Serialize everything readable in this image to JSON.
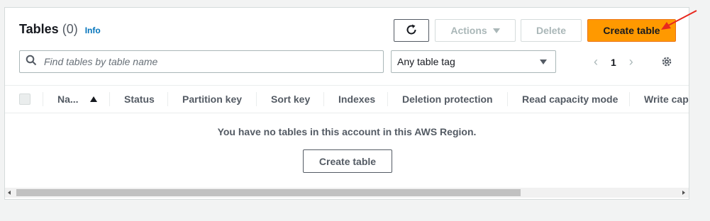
{
  "header": {
    "title": "Tables",
    "count": "(0)",
    "info_label": "Info"
  },
  "toolbar": {
    "refresh_icon": "refresh-icon",
    "actions_label": "Actions",
    "delete_label": "Delete",
    "create_label": "Create table",
    "create_color": "#ff9900"
  },
  "filter": {
    "search_placeholder": "Find tables by table name",
    "search_value": "",
    "tag_select": "Any table tag"
  },
  "pagination": {
    "prev": "‹",
    "page": "1",
    "next": "›"
  },
  "table": {
    "columns": [
      "Na...",
      "Status",
      "Partition key",
      "Sort key",
      "Indexes",
      "Deletion protection",
      "Read capacity mode",
      "Write capa"
    ],
    "sorted_column": "Na...",
    "sort_direction": "ascending",
    "empty_message": "You have no tables in this account in this AWS Region.",
    "empty_create_label": "Create table"
  },
  "annotation": {
    "color": "#e8281e"
  }
}
